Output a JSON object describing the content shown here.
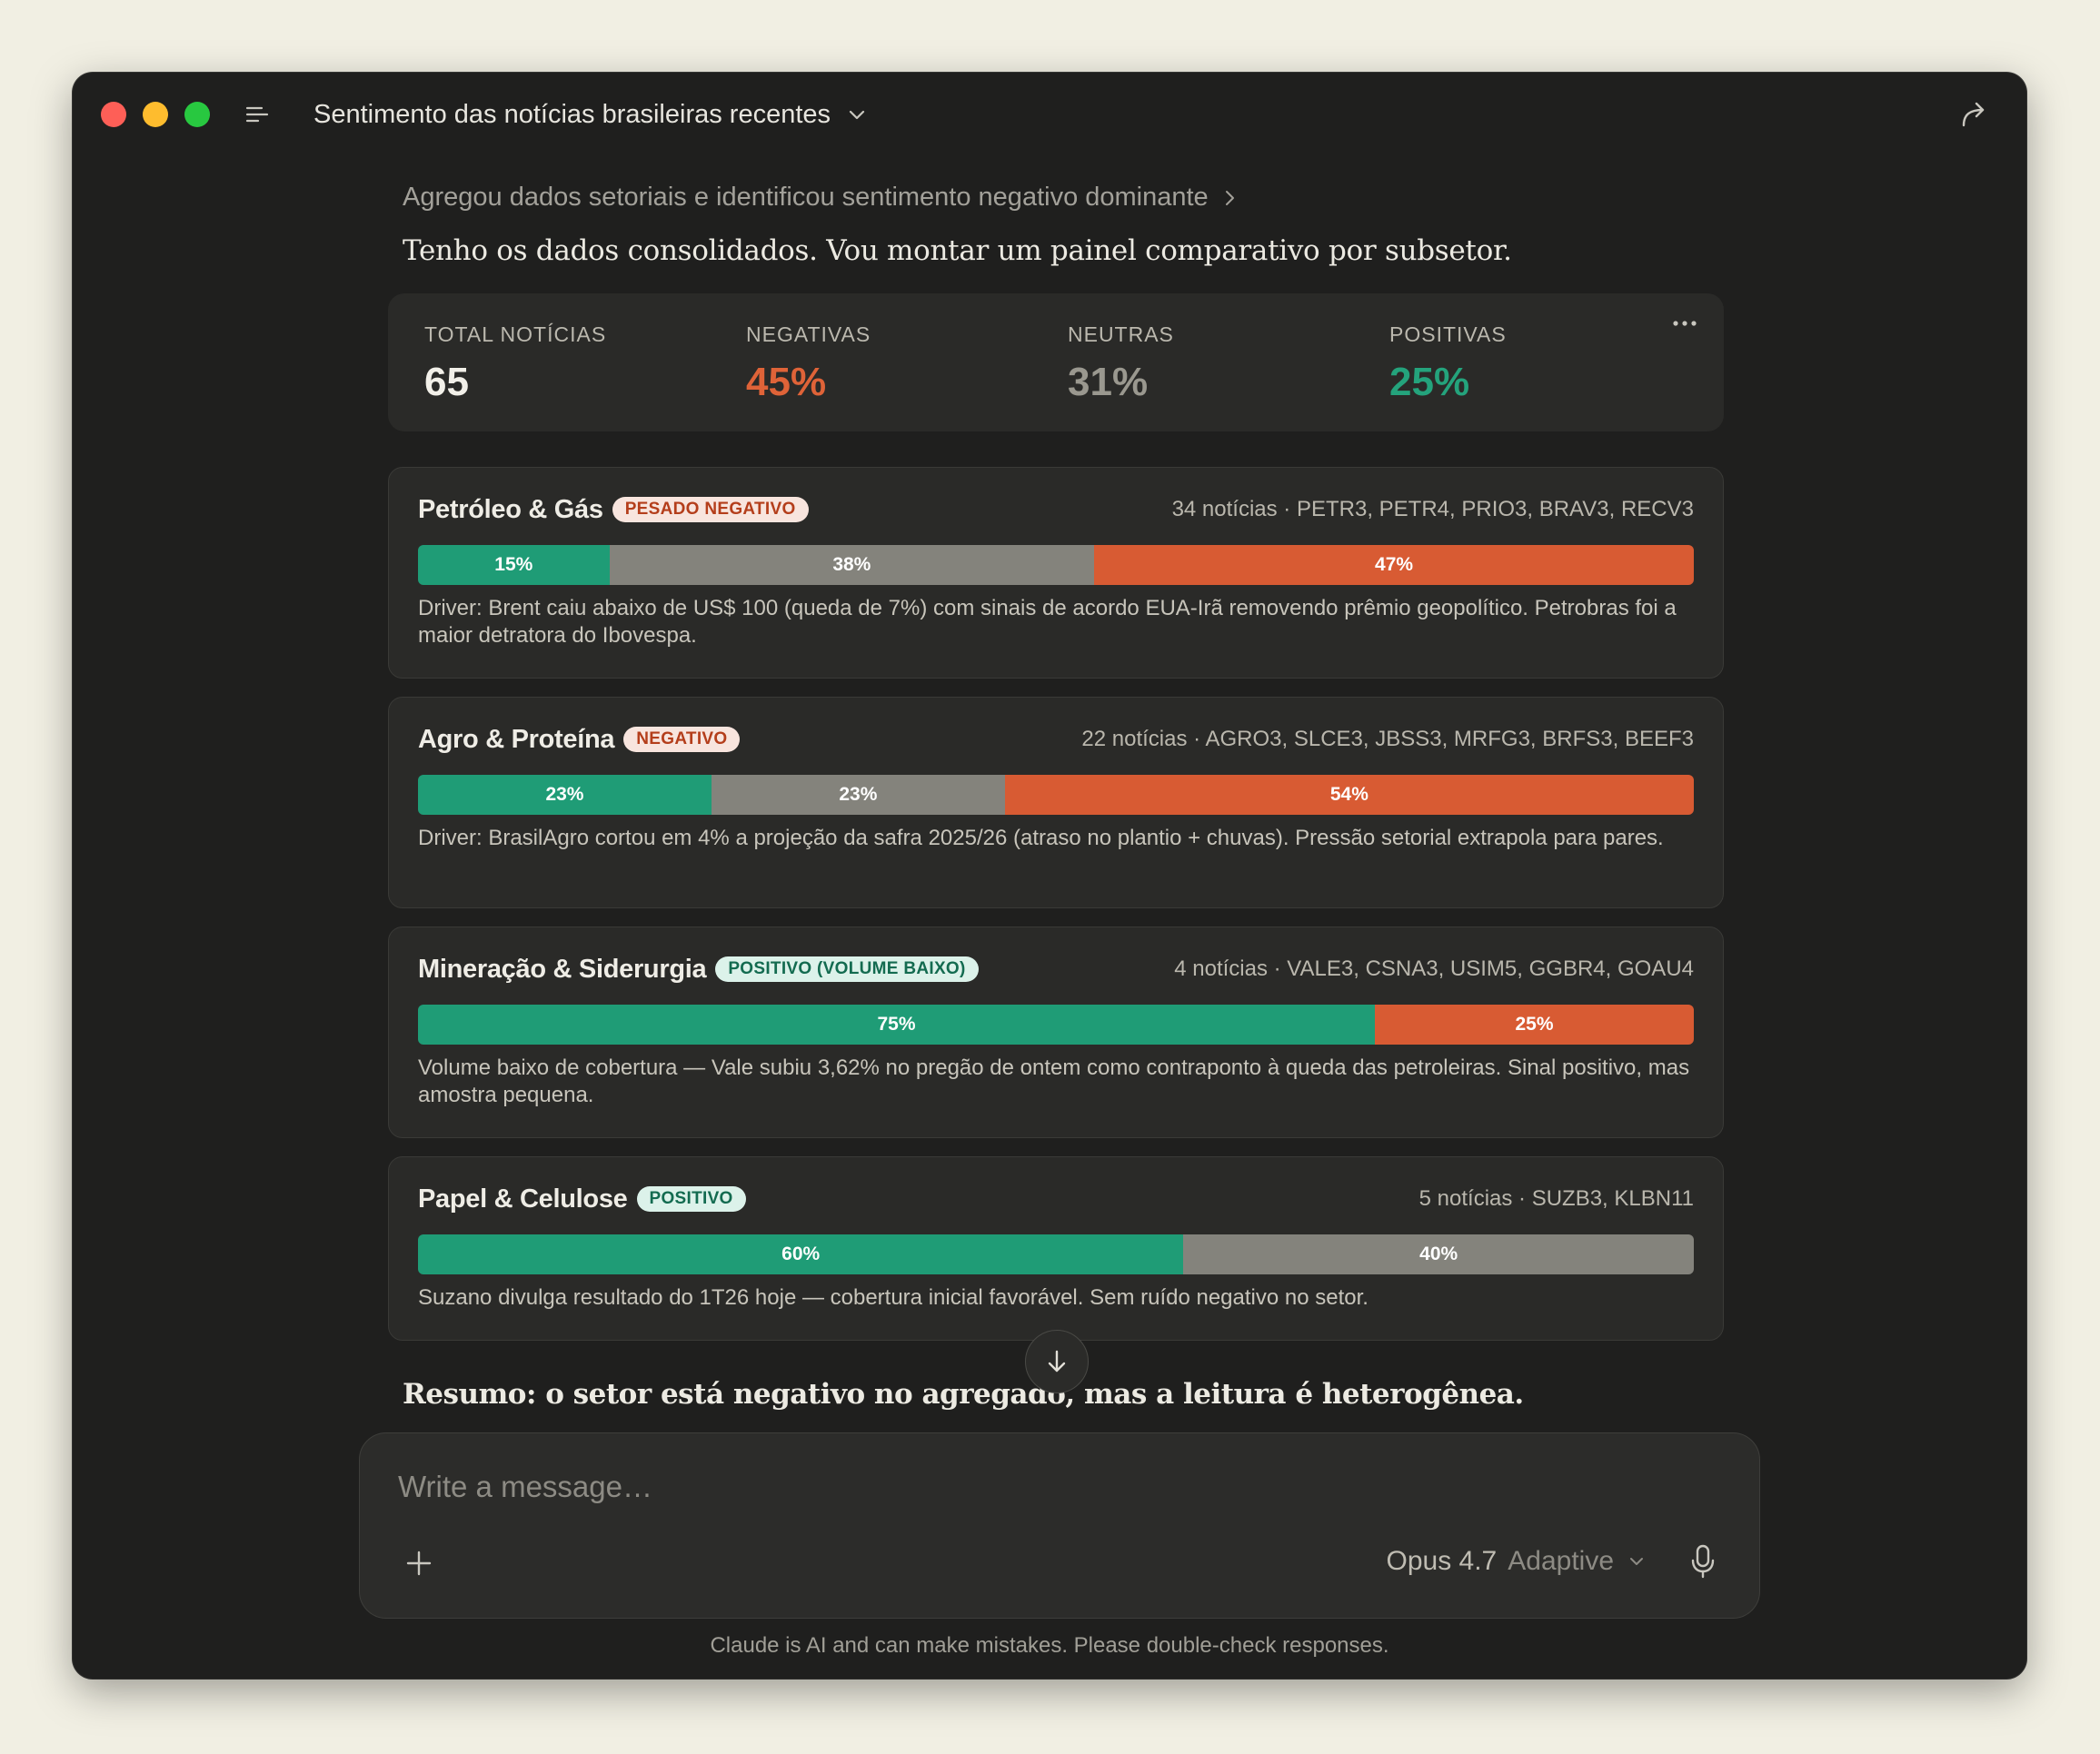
{
  "window": {
    "title": "Sentimento das notícias brasileiras recentes"
  },
  "thread": {
    "summary_step": "Agregou dados setoriais e identificou sentimento negativo dominante",
    "lead_text": "Tenho os dados consolidados. Vou montar um painel comparativo por subsetor.",
    "resumo": "Resumo: o setor está negativo no agregado, mas a leitura é heterogênea."
  },
  "stats": [
    {
      "label": "TOTAL NOTÍCIAS",
      "value": "65",
      "color": "#f2f0e9"
    },
    {
      "label": "NEGATIVAS",
      "value": "45%",
      "color": "#df6338"
    },
    {
      "label": "NEUTRAS",
      "value": "31%",
      "color": "#9a988f"
    },
    {
      "label": "POSITIVAS",
      "value": "25%",
      "color": "#24a37c"
    }
  ],
  "sectors": [
    {
      "name": "Petróleo & Gás",
      "badge": "PESADO NEGATIVO",
      "badge_type": "neg",
      "meta": "34 notícias · PETR3, PETR4, PRIO3, BRAV3, RECV3",
      "segments": [
        {
          "type": "pos",
          "pct": 15,
          "label": "15%"
        },
        {
          "type": "neu",
          "pct": 38,
          "label": "38%"
        },
        {
          "type": "neg",
          "pct": 47,
          "label": "47%"
        }
      ],
      "desc": "Driver: Brent caiu abaixo de US$ 100 (queda de 7%) com sinais de acordo EUA-Irã removendo prêmio geopolítico. Petrobras foi a maior detratora do Ibovespa."
    },
    {
      "name": "Agro & Proteína",
      "badge": "NEGATIVO",
      "badge_type": "neg",
      "meta": "22 notícias · AGRO3, SLCE3, JBSS3, MRFG3, BRFS3, BEEF3",
      "segments": [
        {
          "type": "pos",
          "pct": 23,
          "label": "23%"
        },
        {
          "type": "neu",
          "pct": 23,
          "label": "23%"
        },
        {
          "type": "neg",
          "pct": 54,
          "label": "54%"
        }
      ],
      "desc": "Driver: BrasilAgro cortou em 4% a projeção da safra 2025/26 (atraso no plantio + chuvas). Pressão setorial extrapola para pares."
    },
    {
      "name": "Mineração & Siderurgia",
      "badge": "POSITIVO (VOLUME BAIXO)",
      "badge_type": "pos",
      "meta": "4 notícias · VALE3, CSNA3, USIM5, GGBR4, GOAU4",
      "segments": [
        {
          "type": "pos",
          "pct": 75,
          "label": "75%"
        },
        {
          "type": "neg",
          "pct": 25,
          "label": "25%"
        }
      ],
      "desc": "Volume baixo de cobertura — Vale subiu 3,62% no pregão de ontem como contraponto à queda das petroleiras. Sinal positivo, mas amostra pequena."
    },
    {
      "name": "Papel & Celulose",
      "badge": "POSITIVO",
      "badge_type": "pos",
      "meta": "5 notícias · SUZB3, KLBN11",
      "segments": [
        {
          "type": "pos",
          "pct": 60,
          "label": "60%"
        },
        {
          "type": "neu",
          "pct": 40,
          "label": "40%"
        }
      ],
      "desc": "Suzano divulga resultado do 1T26 hoje — cobertura inicial favorável. Sem ruído negativo no setor."
    }
  ],
  "composer": {
    "placeholder": "Write a message…",
    "model": "Opus 4.7",
    "mode": "Adaptive"
  },
  "footer": {
    "disclaimer": "Claude is AI and can make mistakes. Please double-check responses."
  },
  "icons": [
    "sidebar-menu-icon",
    "chevron-down-icon",
    "share-icon",
    "chevron-right-icon",
    "more-icon",
    "arrow-down-icon",
    "plus-icon",
    "mic-icon"
  ]
}
